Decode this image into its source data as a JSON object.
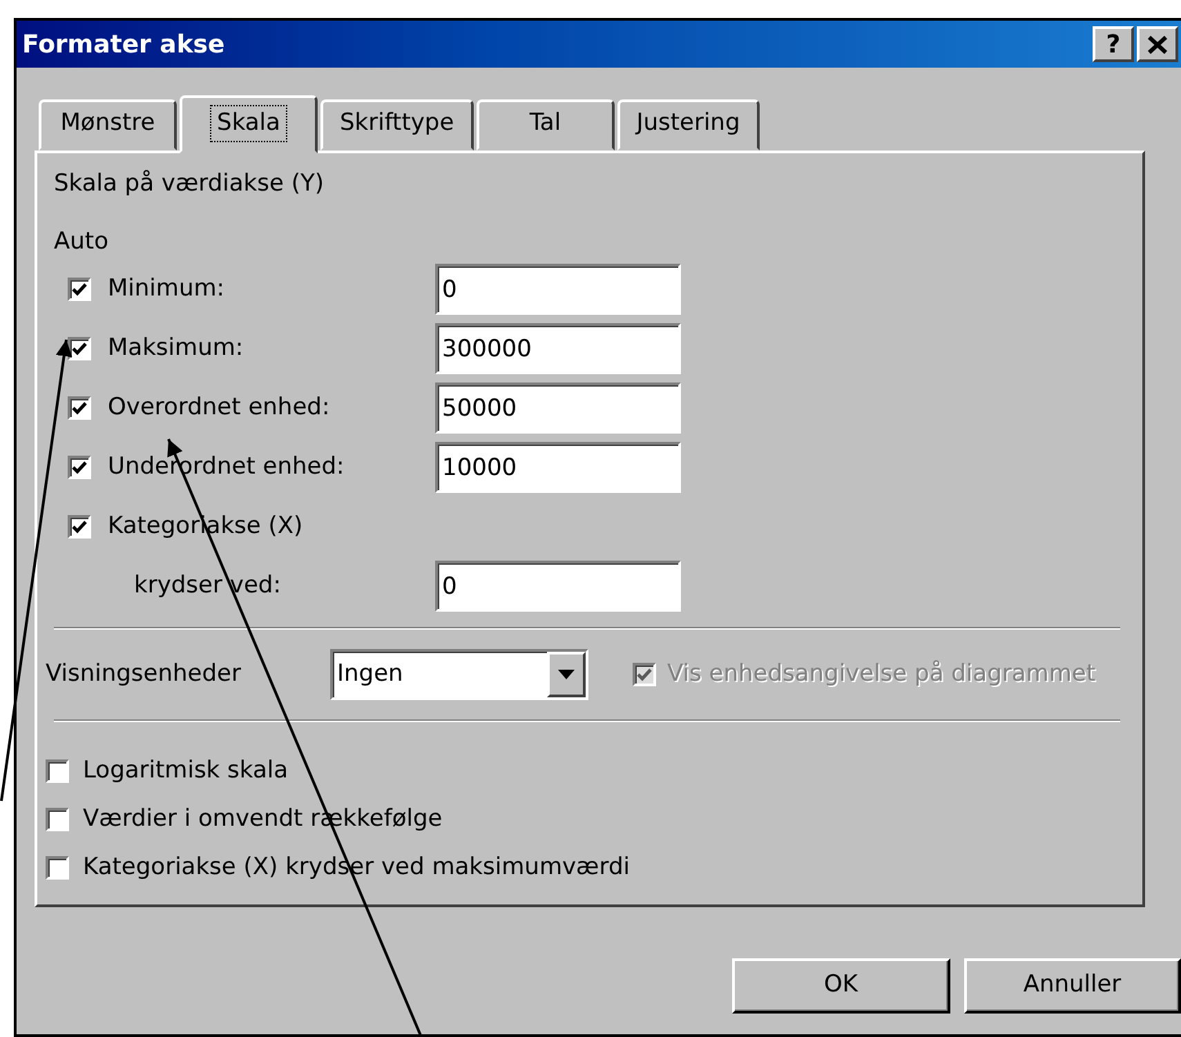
{
  "window": {
    "title": "Formater akse",
    "help": "?"
  },
  "tabs": [
    {
      "label": "Mønstre",
      "selected": false
    },
    {
      "label": "Skala",
      "selected": true
    },
    {
      "label": "Skrifttype",
      "selected": false
    },
    {
      "label": "Tal",
      "selected": false
    },
    {
      "label": "Justering",
      "selected": false
    }
  ],
  "section_title": "Skala på værdiakse (Y)",
  "auto_label": "Auto",
  "scale_rows": [
    {
      "kind": "checkbox-field",
      "label": "Minimum:",
      "checked": true,
      "value": "0"
    },
    {
      "kind": "checkbox-field",
      "label": "Maksimum:",
      "checked": true,
      "value": "300000"
    },
    {
      "kind": "checkbox-field",
      "label": "Overordnet enhed:",
      "checked": true,
      "value": "50000"
    },
    {
      "kind": "checkbox-field",
      "label": "Underordnet enhed:",
      "checked": true,
      "value": "10000"
    },
    {
      "kind": "checkbox",
      "label": "Kategoriakse (X)",
      "checked": true
    },
    {
      "kind": "field",
      "label": "krydser ved:",
      "value": "0"
    }
  ],
  "display_units": {
    "label": "Visningsenheder",
    "value": "Ingen"
  },
  "show_units_label": {
    "label": "Vis enhedsangivelse på diagrammet",
    "checked": true,
    "disabled": true
  },
  "options": [
    {
      "label": "Logaritmisk skala",
      "checked": false
    },
    {
      "label": "Værdier i omvendt rækkefølge",
      "checked": false
    },
    {
      "label": "Kategoriakse (X) krydser ved maksimumværdi",
      "checked": false
    }
  ],
  "buttons": [
    "OK",
    "Annuller"
  ]
}
